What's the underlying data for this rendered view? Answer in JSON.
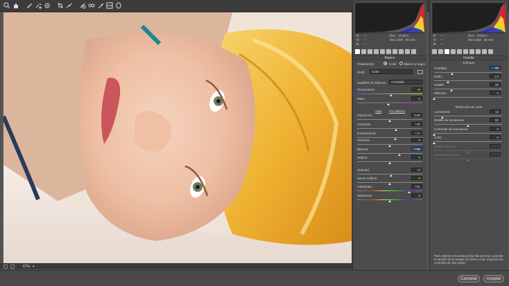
{
  "toolbar": {
    "tools": [
      "zoom-icon",
      "hand-icon",
      "white-balance-icon",
      "color-sampler-icon",
      "target-adjust-icon",
      "crop-icon",
      "straighten-icon",
      "spot-removal-icon",
      "red-eye-icon",
      "adjustment-brush-icon",
      "graduated-filter-icon",
      "radial-filter-icon"
    ]
  },
  "status": {
    "zoom": "67%"
  },
  "buttons": {
    "cancel": "Cancelar",
    "accept": "Aceptar"
  },
  "histogram": {
    "readout": {
      "r_label": "R:",
      "g_label": "G:",
      "b_label": "B:",
      "r_value": "---",
      "g_value": "---",
      "b_value": "---",
      "aperture": "f/5,6",
      "shutter": "1/125 s",
      "iso": "ISO 1250",
      "focal": "35 mm"
    }
  },
  "basic": {
    "section_title": "Básico",
    "treatment_label": "Tratamiento:",
    "treatment_color": "Color",
    "treatment_bw": "Blanco y negro",
    "profile_label": "Perfil:",
    "profile_value": "Color",
    "wb_label": "Equilibrio de blancos:",
    "wb_value": "A medida",
    "auto": "Auto",
    "default": "Por defecto",
    "sliders": [
      {
        "label": "Temperatura",
        "value": "+5",
        "pos": 0.52,
        "kind": "temp"
      },
      {
        "label": "Matiz",
        "value": "-4",
        "pos": 0.48,
        "kind": "tint"
      },
      {
        "label": "Exposición",
        "value": "0,00",
        "pos": 0.5,
        "kind": "plain"
      },
      {
        "label": "Contraste",
        "value": "+20",
        "pos": 0.6,
        "kind": "plain"
      },
      {
        "label": "Iluminaciones",
        "value": "+17",
        "pos": 0.58,
        "kind": "plain"
      },
      {
        "label": "Sombras",
        "value": "0",
        "pos": 0.5,
        "kind": "plain"
      },
      {
        "label": "Blancos",
        "value": "+31",
        "pos": 0.65,
        "kind": "plain",
        "hl": true
      },
      {
        "label": "Negros",
        "value": "0",
        "pos": 0.5,
        "kind": "plain"
      },
      {
        "label": "Claridad",
        "value": "+4",
        "pos": 0.52,
        "kind": "plain"
      },
      {
        "label": "Borrar neblina",
        "value": "0",
        "pos": 0.5,
        "kind": "plain"
      },
      {
        "label": "Intensidad",
        "value": "+61",
        "pos": 0.8,
        "kind": "vib"
      },
      {
        "label": "Saturación",
        "value": "0",
        "pos": 0.5,
        "kind": "sat"
      }
    ]
  },
  "detail": {
    "section_title": "Detalle",
    "sharpen_title": "Enfoque",
    "sharpen": [
      {
        "label": "Cantidad",
        "value": "41",
        "pos": 0.27,
        "hl": true
      },
      {
        "label": "Radio",
        "value": "1,0",
        "pos": 0.2
      },
      {
        "label": "Detalle",
        "value": "25",
        "pos": 0.25
      },
      {
        "label": "Máscara",
        "value": "0",
        "pos": 0.0
      }
    ],
    "noise_title": "Reducción de ruido",
    "noise": [
      {
        "label": "Luminancia",
        "value": "12",
        "pos": 0.12,
        "disabled": false
      },
      {
        "label": "Detalle de luminancia",
        "value": "50",
        "pos": 0.5,
        "disabled": false
      },
      {
        "label": "Contraste de luminancia",
        "value": "0",
        "pos": 0.0,
        "disabled": false
      },
      {
        "label": "Color",
        "value": "0",
        "pos": 0.0,
        "disabled": false
      },
      {
        "label": "Detalle del color",
        "value": "",
        "pos": 0.5,
        "disabled": true
      },
      {
        "label": "Suavidad del color",
        "value": "",
        "pos": 0.5,
        "disabled": true
      }
    ],
    "note": "Para obtener una vista previa más precisa, aumente el tamaño de la imagen al 100% o más al ajustar los controles de este panel."
  }
}
